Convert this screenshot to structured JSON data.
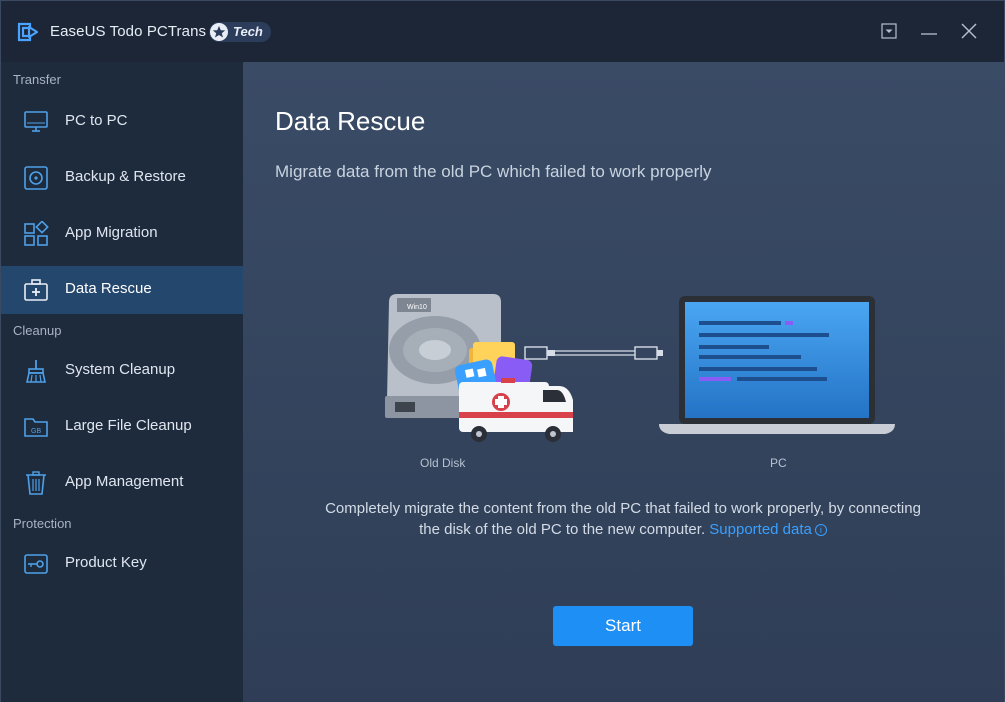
{
  "app": {
    "title": "EaseUS Todo PCTrans",
    "badge": "Tech"
  },
  "sidebar": {
    "sections": [
      {
        "label": "Transfer"
      },
      {
        "label": "Cleanup"
      },
      {
        "label": "Protection"
      }
    ],
    "items": [
      {
        "label": "PC to PC",
        "icon": "monitor-icon"
      },
      {
        "label": "Backup & Restore",
        "icon": "backup-restore-icon"
      },
      {
        "label": "App Migration",
        "icon": "app-migration-icon"
      },
      {
        "label": "Data Rescue",
        "icon": "first-aid-kit-icon",
        "active": true
      },
      {
        "label": "System Cleanup",
        "icon": "broom-icon"
      },
      {
        "label": "Large File Cleanup",
        "icon": "gb-folder-icon"
      },
      {
        "label": "App Management",
        "icon": "trash-icon"
      },
      {
        "label": "Product Key",
        "icon": "key-icon"
      }
    ]
  },
  "main": {
    "title": "Data Rescue",
    "subtitle": "Migrate data from the old PC which failed to work properly",
    "illustration": {
      "disk_label": "Win10",
      "old_disk_caption": "Old Disk",
      "pc_caption": "PC"
    },
    "description": "Completely migrate the content from the old PC that failed to work properly, by connecting the disk of the old PC to the new computer.",
    "supported_link": "Supported data",
    "info_glyph": "i",
    "start_label": "Start"
  },
  "colors": {
    "accent": "#1e90f5",
    "link": "#3aa0ff",
    "active_nav": "#24476d"
  }
}
